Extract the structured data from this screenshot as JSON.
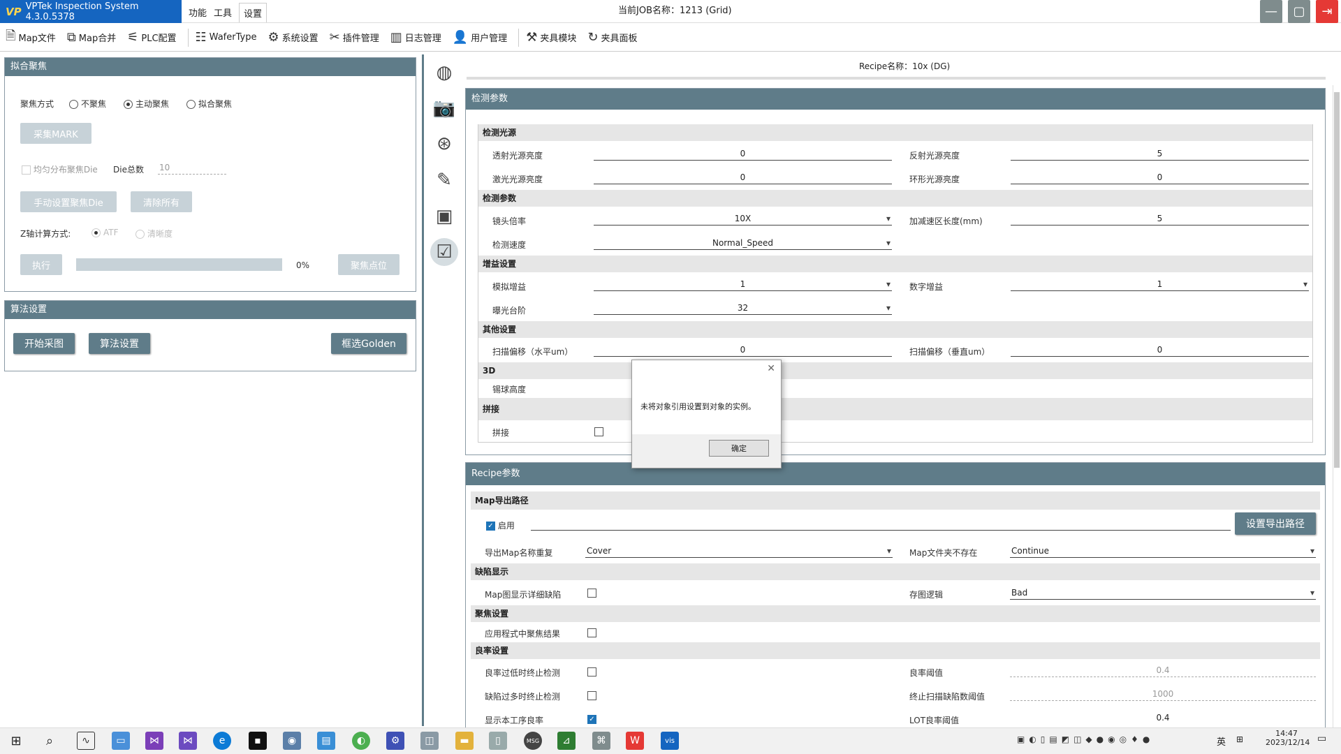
{
  "app": {
    "title": "VPTek Inspection System 4.3.0.5378",
    "logo": "VP"
  },
  "menu": [
    "功能",
    "工具",
    "设置"
  ],
  "job_label": "当前JOB名称：1213 (Grid)",
  "toolbar": [
    {
      "label": "Map文件",
      "icon": "map-file-icon"
    },
    {
      "label": "Map合并",
      "icon": "map-merge-icon"
    },
    {
      "label": "PLC配置",
      "icon": "plc-icon"
    },
    {
      "label": "WaferType",
      "icon": "wafer-type-icon"
    },
    {
      "label": "系统设置",
      "icon": "gear-icon"
    },
    {
      "label": "插件管理",
      "icon": "plugin-icon"
    },
    {
      "label": "日志管理",
      "icon": "log-icon"
    },
    {
      "label": "用户管理",
      "icon": "user-icon"
    },
    {
      "label": "夹具模块",
      "icon": "fixture-icon"
    },
    {
      "label": "夹具面板",
      "icon": "fixture-panel-icon"
    }
  ],
  "focus_panel": {
    "title": "拟合聚焦",
    "focus_mode_label": "聚焦方式",
    "options": [
      "不聚焦",
      "主动聚焦",
      "拟合聚焦"
    ],
    "selected": "主动聚焦",
    "collect_mark": "采集MARK",
    "uniform_die": "均匀分布聚焦Die",
    "die_total_label": "Die总数",
    "die_total": "10",
    "manual_die": "手动设置聚焦Die",
    "clear_all": "清除所有",
    "z_calc_label": "Z轴计算方式:",
    "z_options": [
      "ATF",
      "清晰度"
    ],
    "execute": "执行",
    "progress": "0%",
    "focus_point": "聚焦点位"
  },
  "algo_panel": {
    "title": "算法设置",
    "start": "开始采图",
    "settings": "算法设置",
    "golden": "框选Golden"
  },
  "recipe_name": "Recipe名称：10x (DG)",
  "detect": {
    "title": "检测参数",
    "light_section": "检测光源",
    "trans_label": "透射光源亮度",
    "trans_value": "0",
    "reflect_label": "反射光源亮度",
    "reflect_value": "5",
    "laser_label": "激光光源亮度",
    "laser_value": "0",
    "ring_label": "环形光源亮度",
    "ring_value": "0",
    "param_section": "检测参数",
    "lens_label": "镜头倍率",
    "lens_value": "10X",
    "accel_label": "加减速区长度(mm)",
    "accel_value": "5",
    "speed_label": "检测速度",
    "speed_value": "Normal_Speed",
    "gain_section": "增益设置",
    "analog_label": "模拟增益",
    "analog_value": "1",
    "digital_label": "数字增益",
    "digital_value": "1",
    "exposure_label": "曝光台阶",
    "exposure_value": "32",
    "other_section": "其他设置",
    "offset_h_label": "扫描偏移（水平um）",
    "offset_h_value": "0",
    "offset_v_label": "扫描偏移（垂直um）",
    "offset_v_value": "0",
    "d3_section": "3D",
    "ball_label": "锡球高度",
    "stitch_section": "拼接",
    "stitch_label": "拼接"
  },
  "recipe": {
    "title": "Recipe参数",
    "map_section": "Map导出路径",
    "enable_label": "启用",
    "set_path": "设置导出路径",
    "dup_label": "导出Map名称重复",
    "dup_value": "Cover",
    "nofolder_label": "Map文件夹不存在",
    "nofolder_value": "Continue",
    "defect_section": "缺陷显示",
    "map_detail_label": "Map图显示详细缺陷",
    "save_logic_label": "存图逻辑",
    "save_logic_value": "Bad",
    "focus_section": "聚焦设置",
    "apply_focus_label": "应用程式中聚焦结果",
    "yield_section": "良率设置",
    "low_yield_label": "良率过低时终止检测",
    "yield_thresh_label": "良率阈值",
    "yield_thresh_value": "0.4",
    "many_defect_label": "缺陷过多时终止检测",
    "scan_defect_label": "终止扫描缺陷数阈值",
    "scan_defect_value": "1000",
    "show_yield_label": "显示本工序良率",
    "lot_yield_label": "LOT良率阈值",
    "lot_yield_value": "0.4"
  },
  "dialog": {
    "message": "未将对象引用设置到对象的实例。",
    "ok": "确定"
  },
  "clock": {
    "time": "14:47",
    "date": "2023/12/14"
  },
  "tray_lang": "英"
}
